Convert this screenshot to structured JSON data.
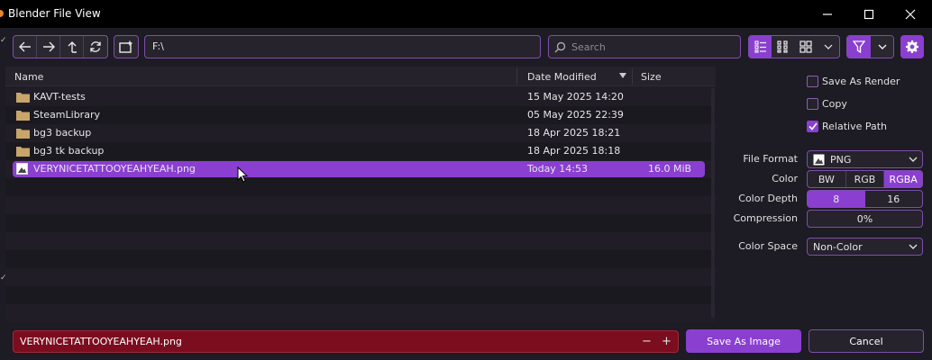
{
  "window": {
    "title": "Blender File View"
  },
  "toolbar": {
    "path": "F:\\",
    "search_placeholder": "Search"
  },
  "columns": {
    "name": "Name",
    "date": "Date Modified",
    "size": "Size"
  },
  "files": [
    {
      "name": "KAVT-tests",
      "date": "15 May 2025 14:20",
      "size": "",
      "type": "folder"
    },
    {
      "name": "SteamLibrary",
      "date": "05 May 2025 22:39",
      "size": "",
      "type": "folder"
    },
    {
      "name": "bg3 backup",
      "date": "18 Apr 2025 18:21",
      "size": "",
      "type": "folder"
    },
    {
      "name": "bg3 tk backup",
      "date": "18 Apr 2025 18:18",
      "size": "",
      "type": "folder"
    },
    {
      "name": "VERYNICETATTOOYEAHYEAH.png",
      "date": "Today 14:53",
      "size": "16.0 MiB",
      "type": "image",
      "selected": true
    }
  ],
  "options": {
    "save_as_render": {
      "label": "Save As Render",
      "checked": false
    },
    "copy": {
      "label": "Copy",
      "checked": false
    },
    "relative_path": {
      "label": "Relative Path",
      "checked": true
    }
  },
  "format": {
    "file_format_label": "File Format",
    "file_format_value": "PNG",
    "color_label": "Color",
    "color_options": [
      "BW",
      "RGB",
      "RGBA"
    ],
    "color_selected": "RGBA",
    "depth_label": "Color Depth",
    "depth_options": [
      "8",
      "16"
    ],
    "depth_selected": "8",
    "compression_label": "Compression",
    "compression_value": "0%",
    "color_space_label": "Color Space",
    "color_space_value": "Non-Color"
  },
  "bottom": {
    "filename": "VERYNICETATTOOYEAHYEAH.png",
    "decrement": "−",
    "increment": "+",
    "save_label": "Save As Image",
    "cancel_label": "Cancel"
  },
  "colors": {
    "accent": "#8a3fd1",
    "filename_error": "#7c0d1f",
    "folder": "#c9a56a"
  }
}
